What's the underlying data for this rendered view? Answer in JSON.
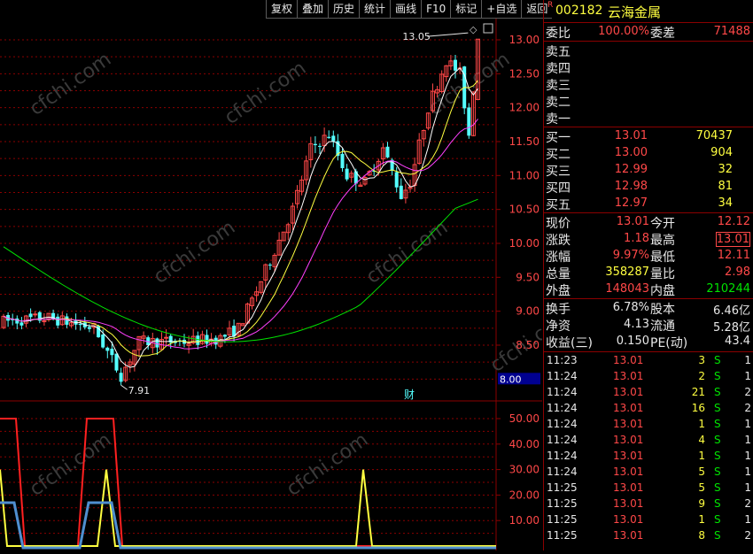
{
  "toolbar": [
    "复权",
    "叠加",
    "历史",
    "统计",
    "画线",
    "F10",
    "标记",
    "+自选",
    "返回"
  ],
  "stock": {
    "badge": "R",
    "code": "002182",
    "name": "云海金属"
  },
  "order_ratio": {
    "label1": "委比",
    "value1": "100.00%",
    "label2": "委差",
    "value2": "71488"
  },
  "asks": [
    {
      "label": "卖五",
      "price": "",
      "vol": ""
    },
    {
      "label": "卖四",
      "price": "",
      "vol": ""
    },
    {
      "label": "卖三",
      "price": "",
      "vol": ""
    },
    {
      "label": "卖二",
      "price": "",
      "vol": ""
    },
    {
      "label": "卖一",
      "price": "",
      "vol": ""
    }
  ],
  "bids": [
    {
      "label": "买一",
      "price": "13.01",
      "vol": "70437"
    },
    {
      "label": "买二",
      "price": "13.00",
      "vol": "904"
    },
    {
      "label": "买三",
      "price": "12.99",
      "vol": "32"
    },
    {
      "label": "买四",
      "price": "12.98",
      "vol": "81"
    },
    {
      "label": "买五",
      "price": "12.97",
      "vol": "34"
    }
  ],
  "quote": [
    {
      "l1": "现价",
      "v1": "13.01",
      "c1": "red",
      "l2": "今开",
      "v2": "12.12",
      "c2": "red"
    },
    {
      "l1": "涨跌",
      "v1": "1.18",
      "c1": "red",
      "l2": "最高",
      "v2": "13.01",
      "c2": "red"
    },
    {
      "l1": "涨幅",
      "v1": "9.97%",
      "c1": "red",
      "l2": "最低",
      "v2": "12.11",
      "c2": "red"
    },
    {
      "l1": "总量",
      "v1": "358287",
      "c1": "yel",
      "l2": "量比",
      "v2": "2.98",
      "c2": "red"
    },
    {
      "l1": "外盘",
      "v1": "148043",
      "c1": "red",
      "l2": "内盘",
      "v2": "210244",
      "c2": "green"
    }
  ],
  "stats": [
    {
      "l1": "换手",
      "v1": "6.78%",
      "l2": "股本",
      "v2": "6.46亿"
    },
    {
      "l1": "净资",
      "v1": "4.13",
      "l2": "流通",
      "v2": "5.28亿"
    },
    {
      "l1": "收益(三)",
      "v1": "0.150",
      "l2": "PE(动)",
      "v2": "43.4"
    }
  ],
  "ticks": [
    {
      "time": "11:23",
      "price": "13.01",
      "vol": "3",
      "side": "S",
      "n": "1"
    },
    {
      "time": "11:24",
      "price": "13.01",
      "vol": "2",
      "side": "S",
      "n": "1"
    },
    {
      "time": "11:24",
      "price": "13.01",
      "vol": "21",
      "side": "S",
      "n": "2"
    },
    {
      "time": "11:24",
      "price": "13.01",
      "vol": "16",
      "side": "S",
      "n": "2"
    },
    {
      "time": "11:24",
      "price": "13.01",
      "vol": "1",
      "side": "S",
      "n": "1"
    },
    {
      "time": "11:24",
      "price": "13.01",
      "vol": "4",
      "side": "S",
      "n": "1"
    },
    {
      "time": "11:24",
      "price": "13.01",
      "vol": "1",
      "side": "S",
      "n": "1"
    },
    {
      "time": "11:24",
      "price": "13.01",
      "vol": "5",
      "side": "S",
      "n": "1"
    },
    {
      "time": "11:25",
      "price": "13.01",
      "vol": "5",
      "side": "S",
      "n": "1"
    },
    {
      "time": "11:25",
      "price": "13.01",
      "vol": "9",
      "side": "S",
      "n": "2"
    },
    {
      "time": "11:25",
      "price": "13.01",
      "vol": "1",
      "side": "S",
      "n": "1"
    },
    {
      "time": "11:25",
      "price": "13.01",
      "vol": "8",
      "side": "S",
      "n": "2"
    }
  ],
  "chart": {
    "price_ticks": [
      "13.00",
      "12.50",
      "12.00",
      "11.50",
      "11.00",
      "10.50",
      "10.00",
      "9.50",
      "9.00",
      "8.50"
    ],
    "crosshair_price": "8.00",
    "high_label": "13.05",
    "low_label": "7.91",
    "fin_marker": "财",
    "indicator_ticks": [
      "50.00",
      "40.00",
      "30.00",
      "20.00",
      "10.00"
    ],
    "watermark": "cfchi.com"
  },
  "colors": {
    "up": "#ff4848",
    "down": "#54ffff",
    "ma5": "#ffffff",
    "ma10": "#ffff40",
    "ma20": "#ff40ff",
    "ma60": "#00e400",
    "grid": "#8b0000"
  }
}
